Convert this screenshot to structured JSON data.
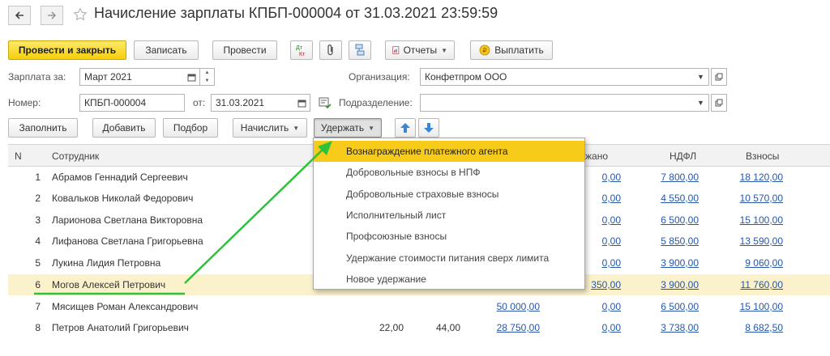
{
  "window": {
    "title": "Начисление зарплаты КПБП-000004 от 31.03.2021 23:59:59"
  },
  "toolbar": {
    "post_close": "Провести и закрыть",
    "save": "Записать",
    "post": "Провести",
    "reports": "Отчеты",
    "pay": "Выплатить"
  },
  "form": {
    "salary_for_label": "Зарплата за:",
    "salary_for_value": "Март 2021",
    "org_label": "Организация:",
    "org_value": "Конфетпром ООО",
    "number_label": "Номер:",
    "number_value": "КПБП-000004",
    "date_label": "от:",
    "date_value": "31.03.2021",
    "subdiv_label": "Подразделение:",
    "subdiv_value": ""
  },
  "table_toolbar": {
    "fill": "Заполнить",
    "add": "Добавить",
    "pick": "Подбор",
    "accrue": "Начислить",
    "deduct": "Удержать"
  },
  "table": {
    "headers": {
      "n": "N",
      "employee": "Сотрудник",
      "withheld": "жано",
      "ndfl": "НДФЛ",
      "contributions": "Взносы"
    },
    "rows": [
      {
        "n": "1",
        "name": "Абрамов Геннадий Сергеевич",
        "h1": "",
        "h2": "",
        "accrued": "",
        "withheld": "0,00",
        "ndfl": "7 800,00",
        "contrib": "18 120,00"
      },
      {
        "n": "2",
        "name": "Ковальков Николай Федорович",
        "h1": "",
        "h2": "",
        "accrued": "",
        "withheld": "0,00",
        "ndfl": "4 550,00",
        "contrib": "10 570,00"
      },
      {
        "n": "3",
        "name": "Ларионова Светлана Викторовна",
        "h1": "",
        "h2": "",
        "accrued": "",
        "withheld": "0,00",
        "ndfl": "6 500,00",
        "contrib": "15 100,00"
      },
      {
        "n": "4",
        "name": "Лифанова Светлана Григорьевна",
        "h1": "",
        "h2": "",
        "accrued": "",
        "withheld": "0,00",
        "ndfl": "5 850,00",
        "contrib": "13 590,00"
      },
      {
        "n": "5",
        "name": "Лукина Лидия Петровна",
        "h1": "",
        "h2": "",
        "accrued": "",
        "withheld": "0,00",
        "ndfl": "3 900,00",
        "contrib": "9 060,00"
      },
      {
        "n": "6",
        "name": "Могов Алексей Петрович",
        "h1": "",
        "h2": "",
        "accrued": "",
        "withheld": "350,00",
        "ndfl": "3 900,00",
        "contrib": "11 760,00"
      },
      {
        "n": "7",
        "name": "Мясищев Роман Александрович",
        "h1": "",
        "h2": "",
        "accrued": "50 000,00",
        "withheld": "0,00",
        "ndfl": "6 500,00",
        "contrib": "15 100,00"
      },
      {
        "n": "8",
        "name": "Петров Анатолий Григорьевич",
        "h1": "22,00",
        "h2": "44,00",
        "accrued": "28 750,00",
        "withheld": "0,00",
        "ndfl": "3 738,00",
        "contrib": "8 682,50"
      }
    ]
  },
  "deduct_menu": {
    "items": [
      "Вознаграждение платежного агента",
      "Добровольные взносы в НПФ",
      "Добровольные страховые взносы",
      "Исполнительный лист",
      "Профсоюзные взносы",
      "Удержание стоимости питания сверх лимита",
      "Новое удержание"
    ],
    "highlighted_index": 0
  },
  "colors": {
    "primary_yellow": "#f6cf0c",
    "menu_highlight": "#f6cb1a",
    "selected_row": "#fbf2cc",
    "link_blue": "#2556a8",
    "annotation_green": "#2ec13a",
    "arrow_blue": "#3a86d6"
  },
  "icons": {
    "back": "arrow-left-icon",
    "forward": "arrow-right-icon",
    "favorite": "star-icon",
    "dt_kt": "debit-credit-icon",
    "attach": "paperclip-icon",
    "structure": "structure-icon",
    "reports": "report-icon",
    "pay": "coin-icon",
    "move_up": "arrow-up-icon",
    "move_down": "arrow-down-icon"
  }
}
